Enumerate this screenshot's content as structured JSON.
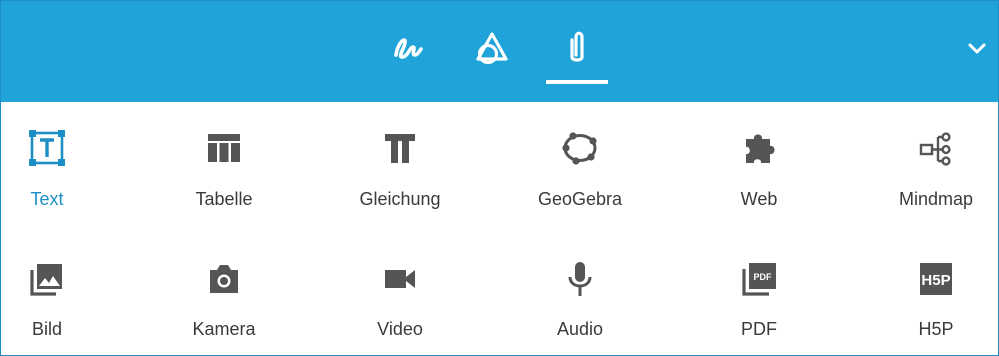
{
  "header": {
    "tabs": [
      {
        "name": "draw-tab",
        "icon": "pen-squiggle-icon",
        "active": false
      },
      {
        "name": "tools-tab",
        "icon": "shapes-icon",
        "active": false
      },
      {
        "name": "media-tab",
        "icon": "paperclip-icon",
        "active": true
      }
    ],
    "collapse_icon": "chevron-down-icon",
    "colors": {
      "bar": "#1fa3d9",
      "active_tool": "#1d8fc4",
      "icon_gray": "#555555"
    }
  },
  "tools": {
    "row1": [
      {
        "label": "Text",
        "icon": "text-box-icon",
        "active": true
      },
      {
        "label": "Tabelle",
        "icon": "table-icon"
      },
      {
        "label": "Gleichung",
        "icon": "equation-icon"
      },
      {
        "label": "GeoGebra",
        "icon": "geogebra-icon"
      },
      {
        "label": "Web",
        "icon": "puzzle-icon"
      },
      {
        "label": "Mindmap",
        "icon": "mindmap-icon"
      }
    ],
    "row2": [
      {
        "label": "Bild",
        "icon": "image-icon"
      },
      {
        "label": "Kamera",
        "icon": "camera-icon"
      },
      {
        "label": "Video",
        "icon": "video-icon"
      },
      {
        "label": "Audio",
        "icon": "microphone-icon"
      },
      {
        "label": "PDF",
        "icon": "pdf-icon",
        "icon_text": "PDF"
      },
      {
        "label": "H5P",
        "icon": "h5p-icon",
        "icon_text": "H5P"
      }
    ]
  }
}
